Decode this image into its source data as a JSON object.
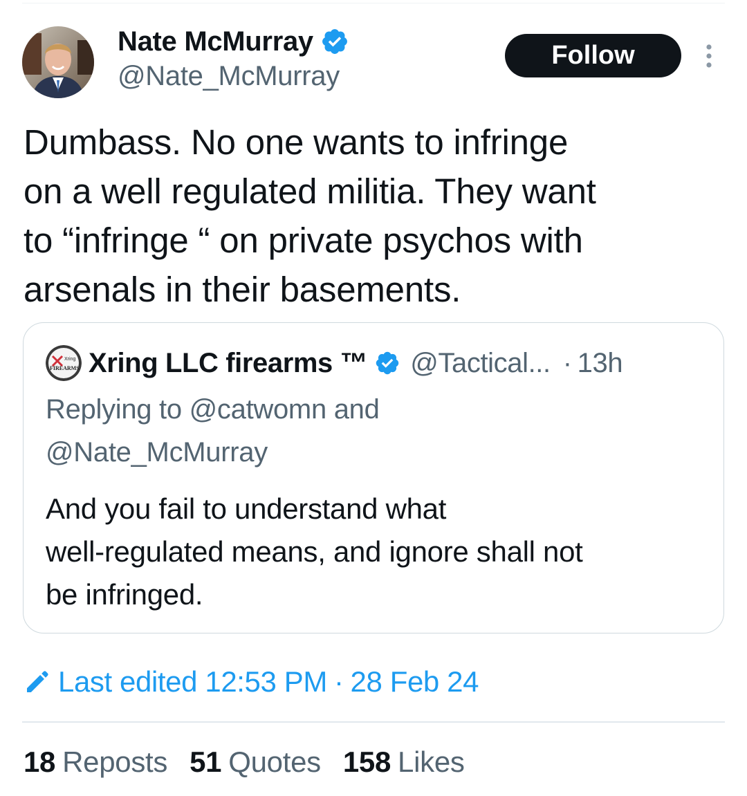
{
  "author": {
    "display_name": "Nate McMurray",
    "handle": "@Nate_McMurray",
    "verified": true
  },
  "follow_button": {
    "label": "Follow"
  },
  "tweet": {
    "lines": [
      "Dumbass. No one wants to infringe",
      "on a well regulated militia. They want",
      "to “infringe “ on private psychos with",
      "arsenals in their basements."
    ]
  },
  "quoted_tweet": {
    "display_name": "Xring LLC firearms ™",
    "handle": "@Tactical...",
    "separator": "·",
    "time": "13h",
    "verified": true,
    "avatar_text": [
      "Xring",
      "FIREARMS"
    ],
    "reply_lines": [
      "Replying to @catwomn and",
      "@Nate_McMurray"
    ],
    "text_lines": [
      "And you fail to understand what",
      "well-regulated means, and ignore shall not",
      "be infringed."
    ]
  },
  "edited": {
    "label": "Last edited 12:53 PM",
    "separator": "·",
    "date": "28 Feb 24"
  },
  "stats": [
    {
      "count": "18",
      "label": "Reposts"
    },
    {
      "count": "51",
      "label": "Quotes"
    },
    {
      "count": "158",
      "label": "Likes"
    }
  ],
  "colors": {
    "accent": "#1d9bf0",
    "text": "#0f1419",
    "secondary": "#536471",
    "button_bg": "#0f1419"
  },
  "icons": {
    "verified": "verified-badge-icon",
    "more": "more-vertical-icon",
    "edit": "pencil-icon"
  }
}
